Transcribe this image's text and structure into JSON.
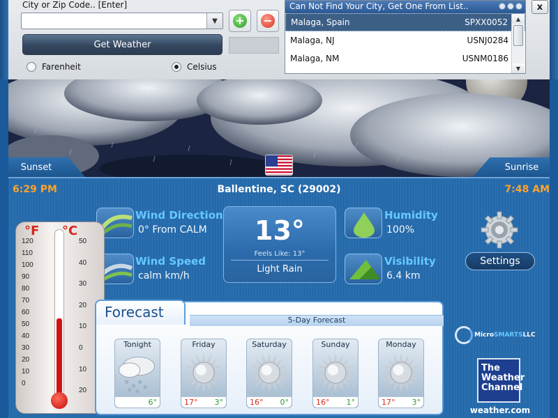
{
  "controls": {
    "city_label": "City or Zip Code..  [Enter]",
    "city_value": "",
    "get_weather_label": "Get Weather",
    "radio_fahrenheit": "Farenheit",
    "radio_celsius": "Celsius",
    "selected_unit": "Celsius",
    "close_label": "x"
  },
  "city_list": {
    "header": "Can Not Find Your City, Get One From List..",
    "rows": [
      {
        "city": "Malaga, Spain",
        "code": "SPXX0052",
        "selected": true
      },
      {
        "city": "Malaga, NJ",
        "code": "USNJ0284",
        "selected": false
      },
      {
        "city": "Malaga, NM",
        "code": "USNM0186",
        "selected": false
      }
    ]
  },
  "sky": {
    "sunset_label": "Sunset",
    "sunrise_label": "Sunrise"
  },
  "status": {
    "sunset_time": "6:29 PM",
    "location": "Ballentine, SC (29002)",
    "sunrise_time": "7:48 AM"
  },
  "stats": {
    "wind_direction_title": "Wind Direction",
    "wind_direction_value": "0° From CALM",
    "wind_speed_title": "Wind Speed",
    "wind_speed_value": "calm km/h",
    "humidity_title": "Humidity",
    "humidity_value": "100%",
    "visibility_title": "Visibility",
    "visibility_value": "6.4 km"
  },
  "current": {
    "temperature": "13°",
    "feels_like": "Feels Like: 13°",
    "condition": "Light Rain"
  },
  "settings_label": "Settings",
  "thermometer": {
    "unit_f": "°F",
    "unit_c": "°C",
    "f_ticks": [
      "120",
      "110",
      "100",
      "90",
      "80",
      "70",
      "60",
      "50",
      "40",
      "30",
      "20",
      "10",
      "0"
    ],
    "c_ticks": [
      "50",
      "40",
      "30",
      "20",
      "10",
      "0",
      "10",
      "20"
    ],
    "level_celsius": 13
  },
  "forecast": {
    "title": "Forecast",
    "subtitle": "5-Day Forecast",
    "days": [
      {
        "name": "Tonight",
        "hi": "",
        "lo": "6°",
        "icon": "rain-cloud-icon"
      },
      {
        "name": "Friday",
        "hi": "17°",
        "lo": "3°",
        "icon": "sun-icon"
      },
      {
        "name": "Saturday",
        "hi": "16°",
        "lo": "0°",
        "icon": "sun-icon"
      },
      {
        "name": "Sunday",
        "hi": "16°",
        "lo": "1°",
        "icon": "sun-icon"
      },
      {
        "name": "Monday",
        "hi": "17°",
        "lo": "3°",
        "icon": "sun-icon"
      }
    ]
  },
  "logos": {
    "micro_a": "Micro",
    "micro_b": "SMARTS",
    "micro_c": "LLC",
    "twc_line1": "The",
    "twc_line2": "Weather",
    "twc_line3": "Channel",
    "twc_url": "weather.com"
  }
}
